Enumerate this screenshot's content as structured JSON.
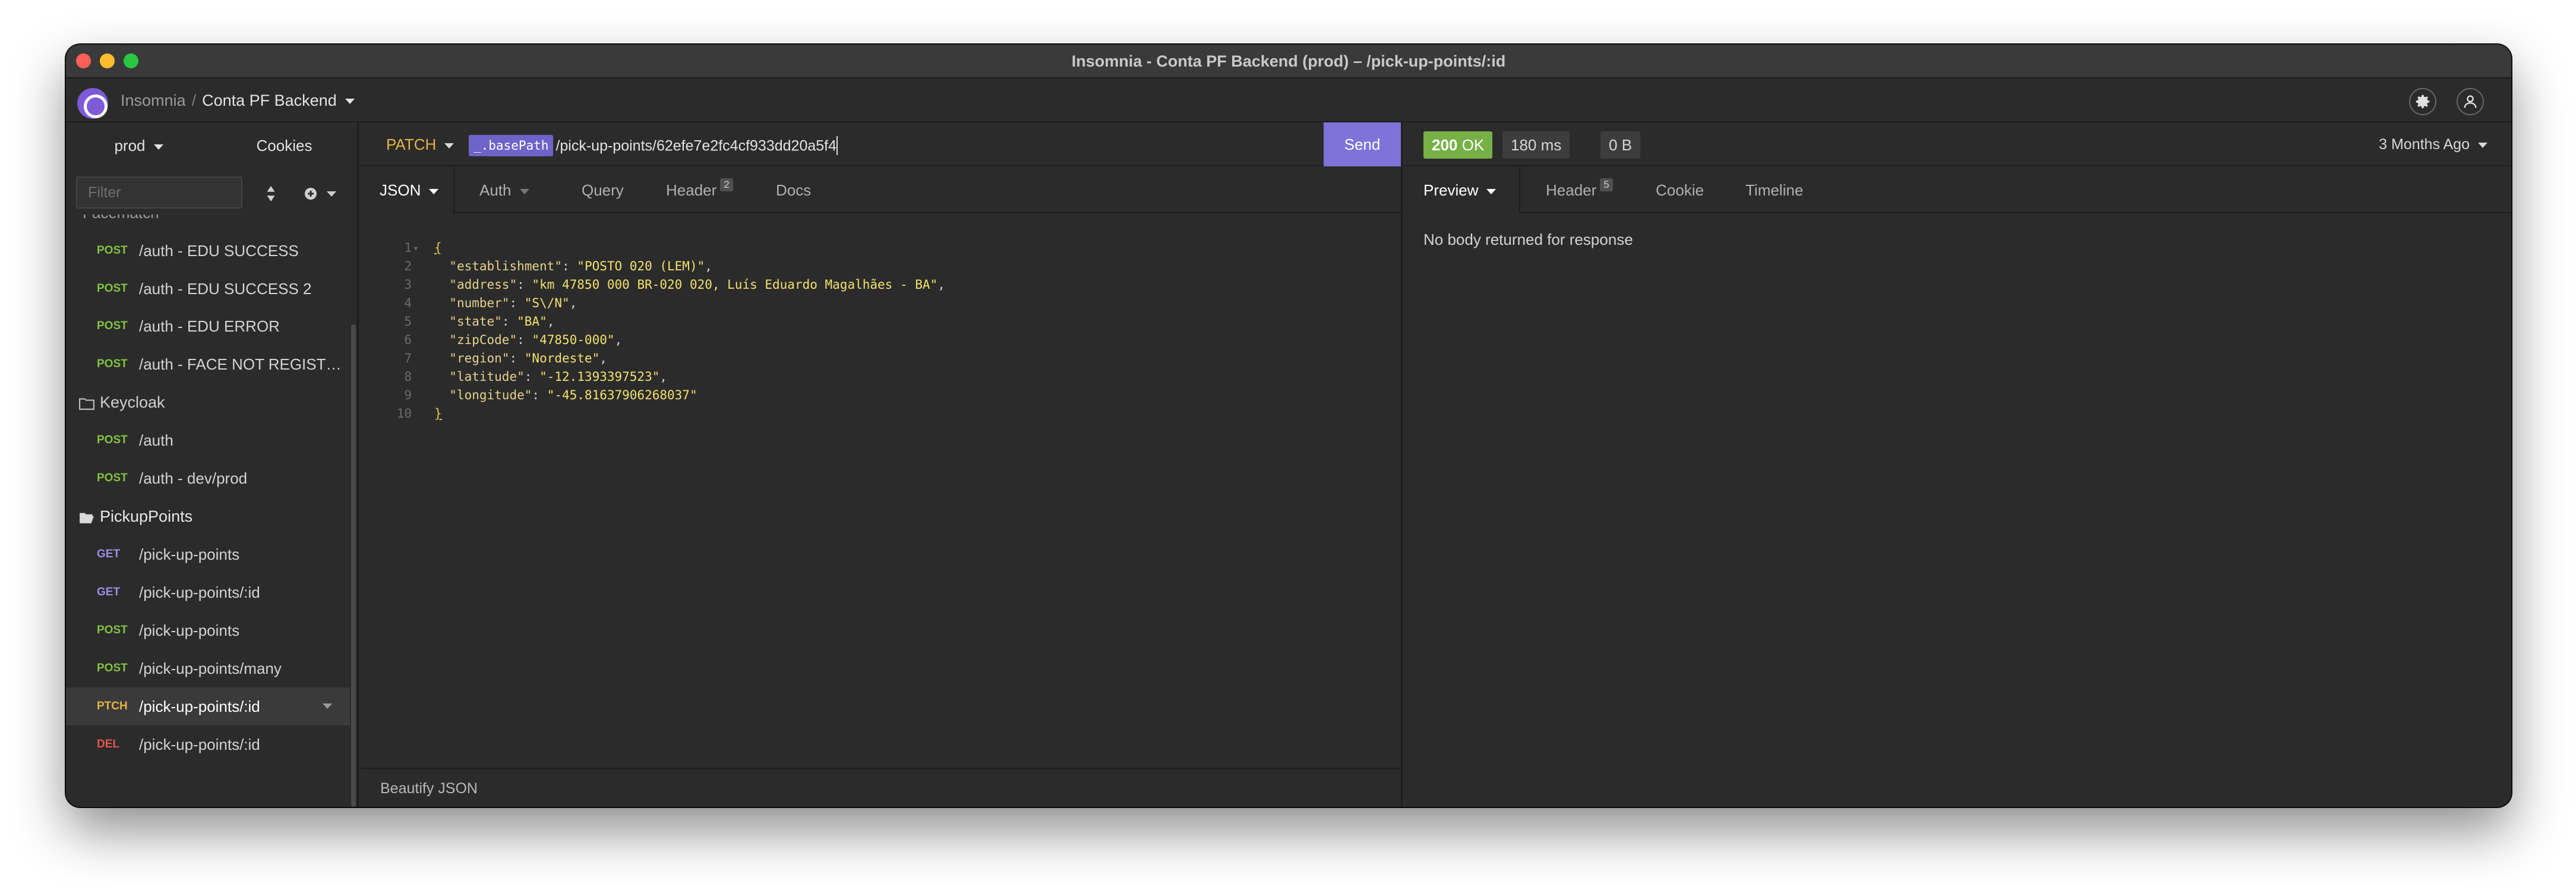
{
  "window": {
    "title": "Insomnia - Conta PF Backend (prod) – /pick-up-points/:id"
  },
  "header": {
    "app_name": "Insomnia",
    "workspace": "Conta PF Backend",
    "separator": "/"
  },
  "sidebar": {
    "environment": "prod",
    "cookies_label": "Cookies",
    "filter_placeholder": "Filter",
    "cut_folder": "Facematch",
    "items": [
      {
        "type": "request",
        "method": "POST",
        "name": "/auth - EDU SUCCESS"
      },
      {
        "type": "request",
        "method": "POST",
        "name": "/auth - EDU SUCCESS 2"
      },
      {
        "type": "request",
        "method": "POST",
        "name": "/auth - EDU ERROR"
      },
      {
        "type": "request",
        "method": "POST",
        "name": "/auth - FACE NOT REGISTE..."
      },
      {
        "type": "folder",
        "name": "Keycloak"
      },
      {
        "type": "request",
        "method": "POST",
        "name": "/auth"
      },
      {
        "type": "request",
        "method": "POST",
        "name": "/auth - dev/prod"
      },
      {
        "type": "folder",
        "name": "PickupPoints"
      },
      {
        "type": "request",
        "method": "GET",
        "name": "/pick-up-points"
      },
      {
        "type": "request",
        "method": "GET",
        "name": "/pick-up-points/:id"
      },
      {
        "type": "request",
        "method": "POST",
        "name": "/pick-up-points"
      },
      {
        "type": "request",
        "method": "POST",
        "name": "/pick-up-points/many"
      },
      {
        "type": "request",
        "method": "PTCH",
        "name": "/pick-up-points/:id"
      },
      {
        "type": "request",
        "method": "DEL",
        "name": "/pick-up-points/:id"
      }
    ]
  },
  "request": {
    "method": "PATCH",
    "url_variable": "_.basePath",
    "url_path": "/pick-up-points/62efe7e2fc4cf933dd20a5f4",
    "send_label": "Send",
    "tabs": {
      "body": "JSON",
      "auth": "Auth",
      "query": "Query",
      "header": "Header",
      "header_count": "2",
      "docs": "Docs"
    },
    "beautify_label": "Beautify JSON",
    "line_numbers": [
      "1",
      "2",
      "3",
      "4",
      "5",
      "6",
      "7",
      "8",
      "9",
      "10"
    ],
    "body_lines": [
      {
        "key": "establishment",
        "value": "POSTO 020 (LEM)"
      },
      {
        "key": "address",
        "value": "km 47850 000 BR-020 020, Luís Eduardo Magalhães - BA"
      },
      {
        "key": "number",
        "value": "S\\/N"
      },
      {
        "key": "state",
        "value": "BA"
      },
      {
        "key": "zipCode",
        "value": "47850-000"
      },
      {
        "key": "region",
        "value": "Nordeste"
      },
      {
        "key": "latitude",
        "value": "-12.1393397523"
      },
      {
        "key": "longitude",
        "value": "-45.81637906268037"
      }
    ]
  },
  "response": {
    "status_code": "200",
    "status_text": "OK",
    "time": "180 ms",
    "size": "0 B",
    "age": "3 Months Ago",
    "tabs": {
      "preview": "Preview",
      "header": "Header",
      "header_count": "5",
      "cookie": "Cookie",
      "timeline": "Timeline"
    },
    "body_message": "No body returned for response"
  },
  "colors": {
    "post": "#82c341",
    "get": "#9b8fe6",
    "patch": "#e4b343",
    "delete": "#e2574c",
    "send_button": "#7f72d9",
    "status_ok": "#77b046"
  },
  "icons": {
    "logo": "insomnia-logo-icon",
    "settings": "gear-icon",
    "account": "user-icon",
    "sort": "sort-icon",
    "add": "plus-circle-icon",
    "folder_closed": "folder-icon",
    "folder_open": "folder-open-icon"
  }
}
